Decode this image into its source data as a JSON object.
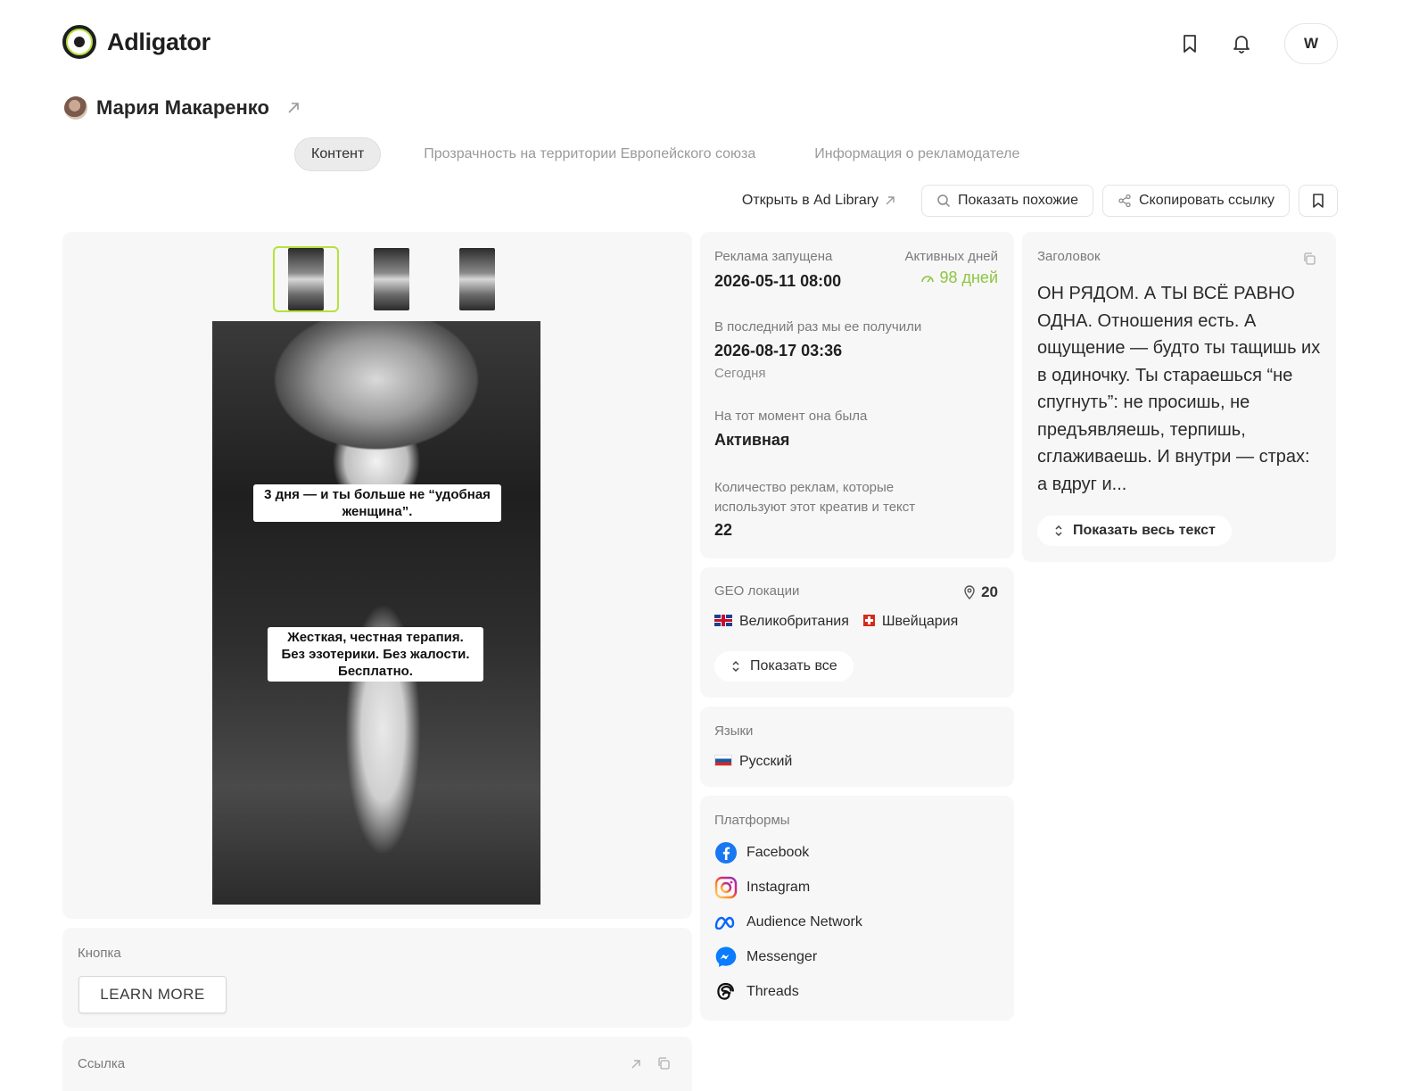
{
  "app": {
    "name": "Adligator",
    "user_initial": "W"
  },
  "advertiser": {
    "name": "Мария Макаренко"
  },
  "tabs": [
    "Контент",
    "Прозрачность на территории Европейского союза",
    "Информация о рекламодателе"
  ],
  "actions": {
    "open_library": "Открыть в Ad Library",
    "show_similar": "Показать похожие",
    "copy_link": "Скопировать ссылку"
  },
  "creative": {
    "caption_top": "3 дня — и ты больше не “удобная женщина”.",
    "caption_bottom": "Жесткая, честная терапия. Без эзотерики. Без жалости. Бесплатно."
  },
  "button_section": {
    "label": "Кнопка",
    "cta": "LEARN MORE"
  },
  "link_section": {
    "label": "Ссылка"
  },
  "stats": {
    "launched_label": "Реклама запущена",
    "launched_value": "2026-05-11 08:00",
    "active_days_label": "Активных дней",
    "active_days_value": "98 дней",
    "last_seen_label": "В последний раз мы ее получили",
    "last_seen_value": "2026-08-17 03:36",
    "last_seen_note": "Сегодня",
    "status_label": "На тот момент она была",
    "status_value": "Активная",
    "count_label": "Количество реклам, которые используют этот креатив и текст",
    "count_value": "22"
  },
  "geo": {
    "label": "GEO локации",
    "count": "20",
    "countries": [
      "Великобритания",
      "Швейцария"
    ],
    "show_all": "Показать все"
  },
  "languages": {
    "label": "Языки",
    "items": [
      "Русский"
    ]
  },
  "platforms": {
    "label": "Платформы",
    "items": [
      "Facebook",
      "Instagram",
      "Audience Network",
      "Messenger",
      "Threads"
    ]
  },
  "headline": {
    "label": "Заголовок",
    "text": "ОН РЯДОМ. А ТЫ ВСЁ РАВНО ОДНА. Отношения есть. А ощущение — будто ты тащишь их в одиночку. Ты стараешься “не спугнуть”: не просишь, не предъявляешь, терпишь, сглаживаешь. И внутри — страх: а вдруг и...",
    "show_full": "Показать весь текст"
  },
  "colors": {
    "accent": "#b6e23b",
    "active_green": "#8cc63f",
    "panel_bg": "#f7f7f7"
  }
}
